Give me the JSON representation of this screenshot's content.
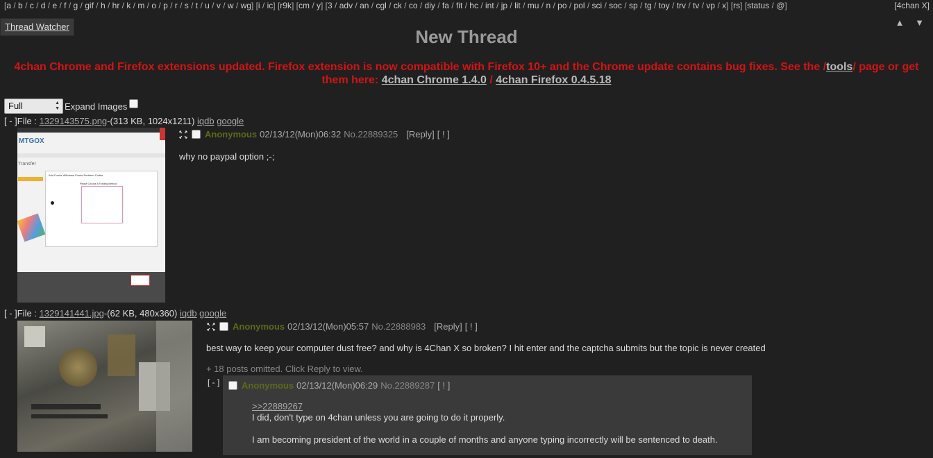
{
  "nav": {
    "boards": [
      "a",
      "b",
      "c",
      "d",
      "e",
      "f",
      "g",
      "gif",
      "h",
      "hr",
      "k",
      "m",
      "o",
      "p",
      "r",
      "s",
      "t",
      "u",
      "v",
      "w",
      "wg",
      "i",
      "ic",
      "r9k",
      "cm",
      "y",
      "3",
      "adv",
      "an",
      "cgl",
      "ck",
      "co",
      "diy",
      "fa",
      "fit",
      "hc",
      "int",
      "jp",
      "lit",
      "mu",
      "n",
      "po",
      "pol",
      "sci",
      "soc",
      "sp",
      "tg",
      "toy",
      "trv",
      "tv",
      "vp",
      "x",
      "rs",
      "status",
      "@"
    ],
    "right": "[4chan X]"
  },
  "thread_watcher": "Thread Watcher",
  "arrows": "▲ ▼",
  "title": "New Thread",
  "notice": {
    "text1": "4chan Chrome and Firefox extensions updated. Firefox extension is now compatible with Firefox 10+ and the Chrome update contains bug fixes. See the /",
    "tools": "tools",
    "text2": "/ page or get them here:",
    "chrome": "4chan Chrome 1.4.0",
    "slash": "/",
    "firefox": "4chan Firefox 0.4.5.18"
  },
  "controls": {
    "select_value": "Full",
    "expand_label": "Expand Images"
  },
  "threads": [
    {
      "file_prefix": "[ - ]File : ",
      "file_name": "1329143575.png",
      "file_meta": "-(313 KB, 1024x1211)",
      "iqdb": "iqdb",
      "google": "google",
      "name": "Anonymous",
      "date": "02/13/12(Mon)06:32",
      "no": "No.22889325",
      "reply_open": "[",
      "reply": "Reply",
      "reply_close": "]",
      "excl": "[ ! ]",
      "comment": "why no paypal option ;-;",
      "thumb": {
        "logo": "MTGOX",
        "heading": "Transfer",
        "tabs": "Add Funds   Withdraw Funds   Redeem Codes",
        "method": "Please Choose A Funding Method:"
      }
    },
    {
      "file_prefix": "[ - ]File : ",
      "file_name": "1329141441.jpg",
      "file_meta": "-(62 KB, 480x360)",
      "iqdb": "iqdb",
      "google": "google",
      "name": "Anonymous",
      "date": "02/13/12(Mon)05:57",
      "no": "No.22888983",
      "reply_open": "[",
      "reply": "Reply",
      "reply_close": "]",
      "excl": "[ ! ]",
      "comment": "best way to keep your computer dust free? and why is 4Chan X so broken? I hit enter and the captcha submits but the topic is never created",
      "omitted": "+ 18 posts omitted. Click Reply to view."
    }
  ],
  "reply": {
    "dash": "[ - ]",
    "name": "Anonymous",
    "date": "02/13/12(Mon)06:29",
    "no": "No.22889287",
    "excl": "[ ! ]",
    "quote": ">>22889267",
    "line1": "I did, don't type on 4chan unless you are going to do it properly.",
    "line2": "I am becoming president of the world in a couple of months and anyone typing incorrectly will be sentenced to death."
  }
}
